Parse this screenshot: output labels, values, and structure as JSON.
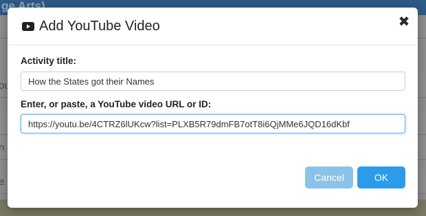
{
  "backdrop": {
    "topbar_text": "ge Arts)",
    "rows": [
      "",
      "ou",
      "",
      "n H",
      "e m"
    ]
  },
  "modal": {
    "title": "Add YouTube Video",
    "close_symbol": "✖",
    "activity_label": "Activity title:",
    "activity_value": "How the States got their Names",
    "url_label": "Enter, or paste, a YouTube video URL or ID:",
    "url_value": "https://youtu.be/4CTRZ6lUKcw?list=PLXB5R79dmFB7otT8i6QjMMe6JQD16dKbf",
    "cancel_label": "Cancel",
    "ok_label": "OK"
  },
  "colors": {
    "primary": "#2d9bea",
    "primary_disabled": "#8cc2ea",
    "focus_border": "#66afe9"
  },
  "icons": {
    "title_icon": "youtube-icon",
    "close_icon": "close-icon"
  }
}
